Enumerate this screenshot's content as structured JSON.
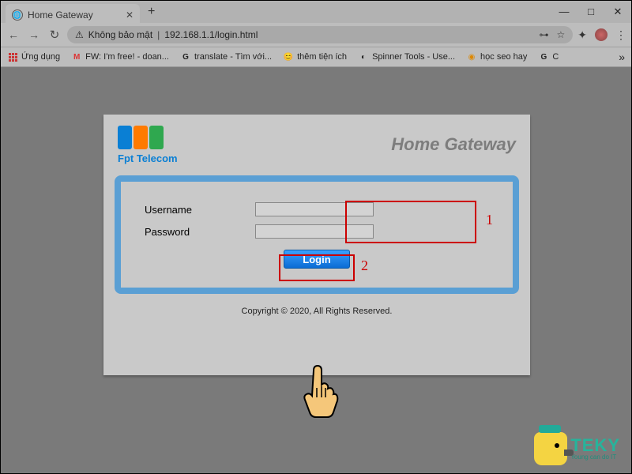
{
  "browser": {
    "tab_title": "Home Gateway",
    "new_tab_glyph": "+",
    "win_min": "—",
    "win_max": "□",
    "win_close": "✕",
    "nav": {
      "back": "←",
      "forward": "→",
      "reload": "↻",
      "insecure_label": "Không bảo mật",
      "url": "192.168.1.1/login.html",
      "key_glyph": "⊶",
      "star_glyph": "☆",
      "ext_glyph": "✦",
      "menu_glyph": "⋮"
    },
    "bookmarks": {
      "apps": "Ứng dụng",
      "items": [
        {
          "icon": "M",
          "label": "FW: I'm free! - doan...",
          "icon_color": "#d33"
        },
        {
          "icon": "G",
          "label": "translate - Tìm với...",
          "icon_color": "#555"
        },
        {
          "icon": "😊",
          "label": "thêm tiện ích",
          "icon_color": ""
        },
        {
          "icon": "◐",
          "label": "Spinner Tools - Use...",
          "icon_color": "#555"
        },
        {
          "icon": "◉",
          "label": "học seo hay",
          "icon_color": "#d80"
        },
        {
          "icon": "G",
          "label": "C",
          "icon_color": "#555"
        }
      ],
      "overflow_glyph": "»"
    }
  },
  "page": {
    "logo_sub": "Fpt Telecom",
    "title": "Home Gateway",
    "form": {
      "username_label": "Username",
      "password_label": "Password",
      "login_label": "Login"
    },
    "annotations": {
      "num1": "1",
      "num2": "2"
    },
    "copyright": "Copyright © 2020,        All Rights Reserved."
  },
  "teky": {
    "brand": "TEKY",
    "tagline": "Young can do IT"
  }
}
